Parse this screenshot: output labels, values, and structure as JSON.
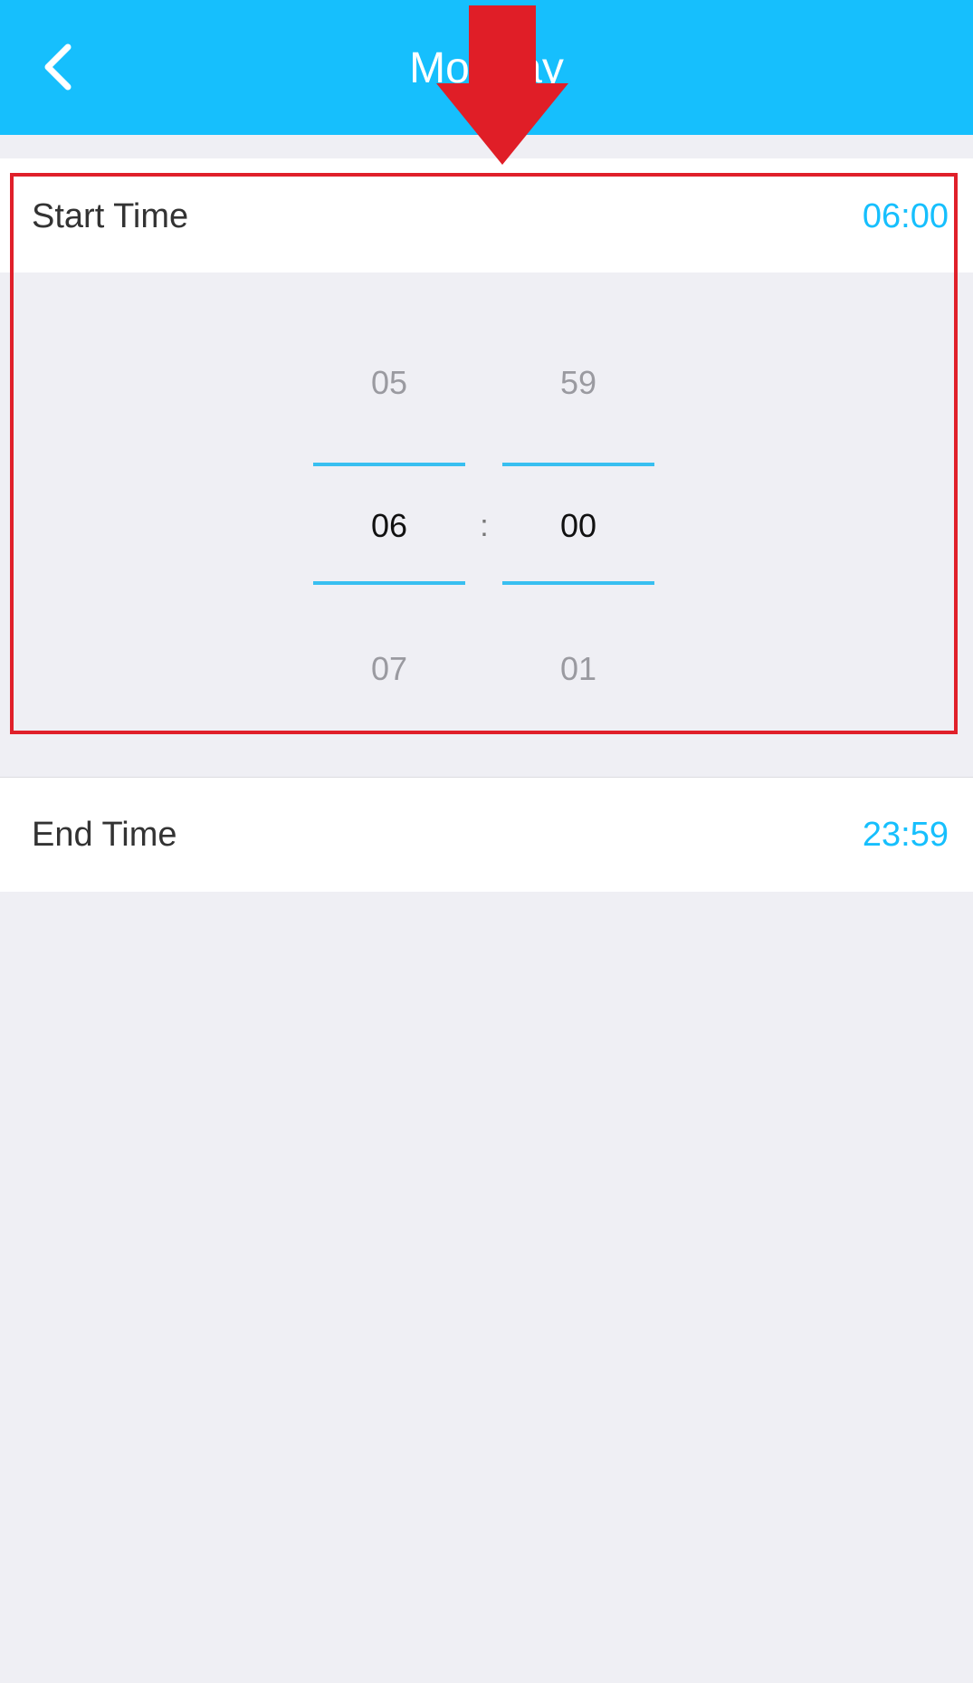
{
  "header": {
    "title": "Monday",
    "back_icon": "chevron-left-icon"
  },
  "start_time": {
    "label": "Start Time",
    "value": "06:00"
  },
  "picker": {
    "hour": {
      "prev": "05",
      "current": "06",
      "next": "07"
    },
    "minute": {
      "prev": "59",
      "current": "00",
      "next": "01"
    },
    "separator": ":"
  },
  "end_time": {
    "label": "End Time",
    "value": "23:59"
  },
  "colors": {
    "header_bg": "#16bffd",
    "accent": "#16bffd",
    "annotation": "#e0202a",
    "background": "#efeff4"
  },
  "annotations": {
    "arrow_icon": "down-arrow-icon",
    "highlight": "red-highlight-box"
  }
}
